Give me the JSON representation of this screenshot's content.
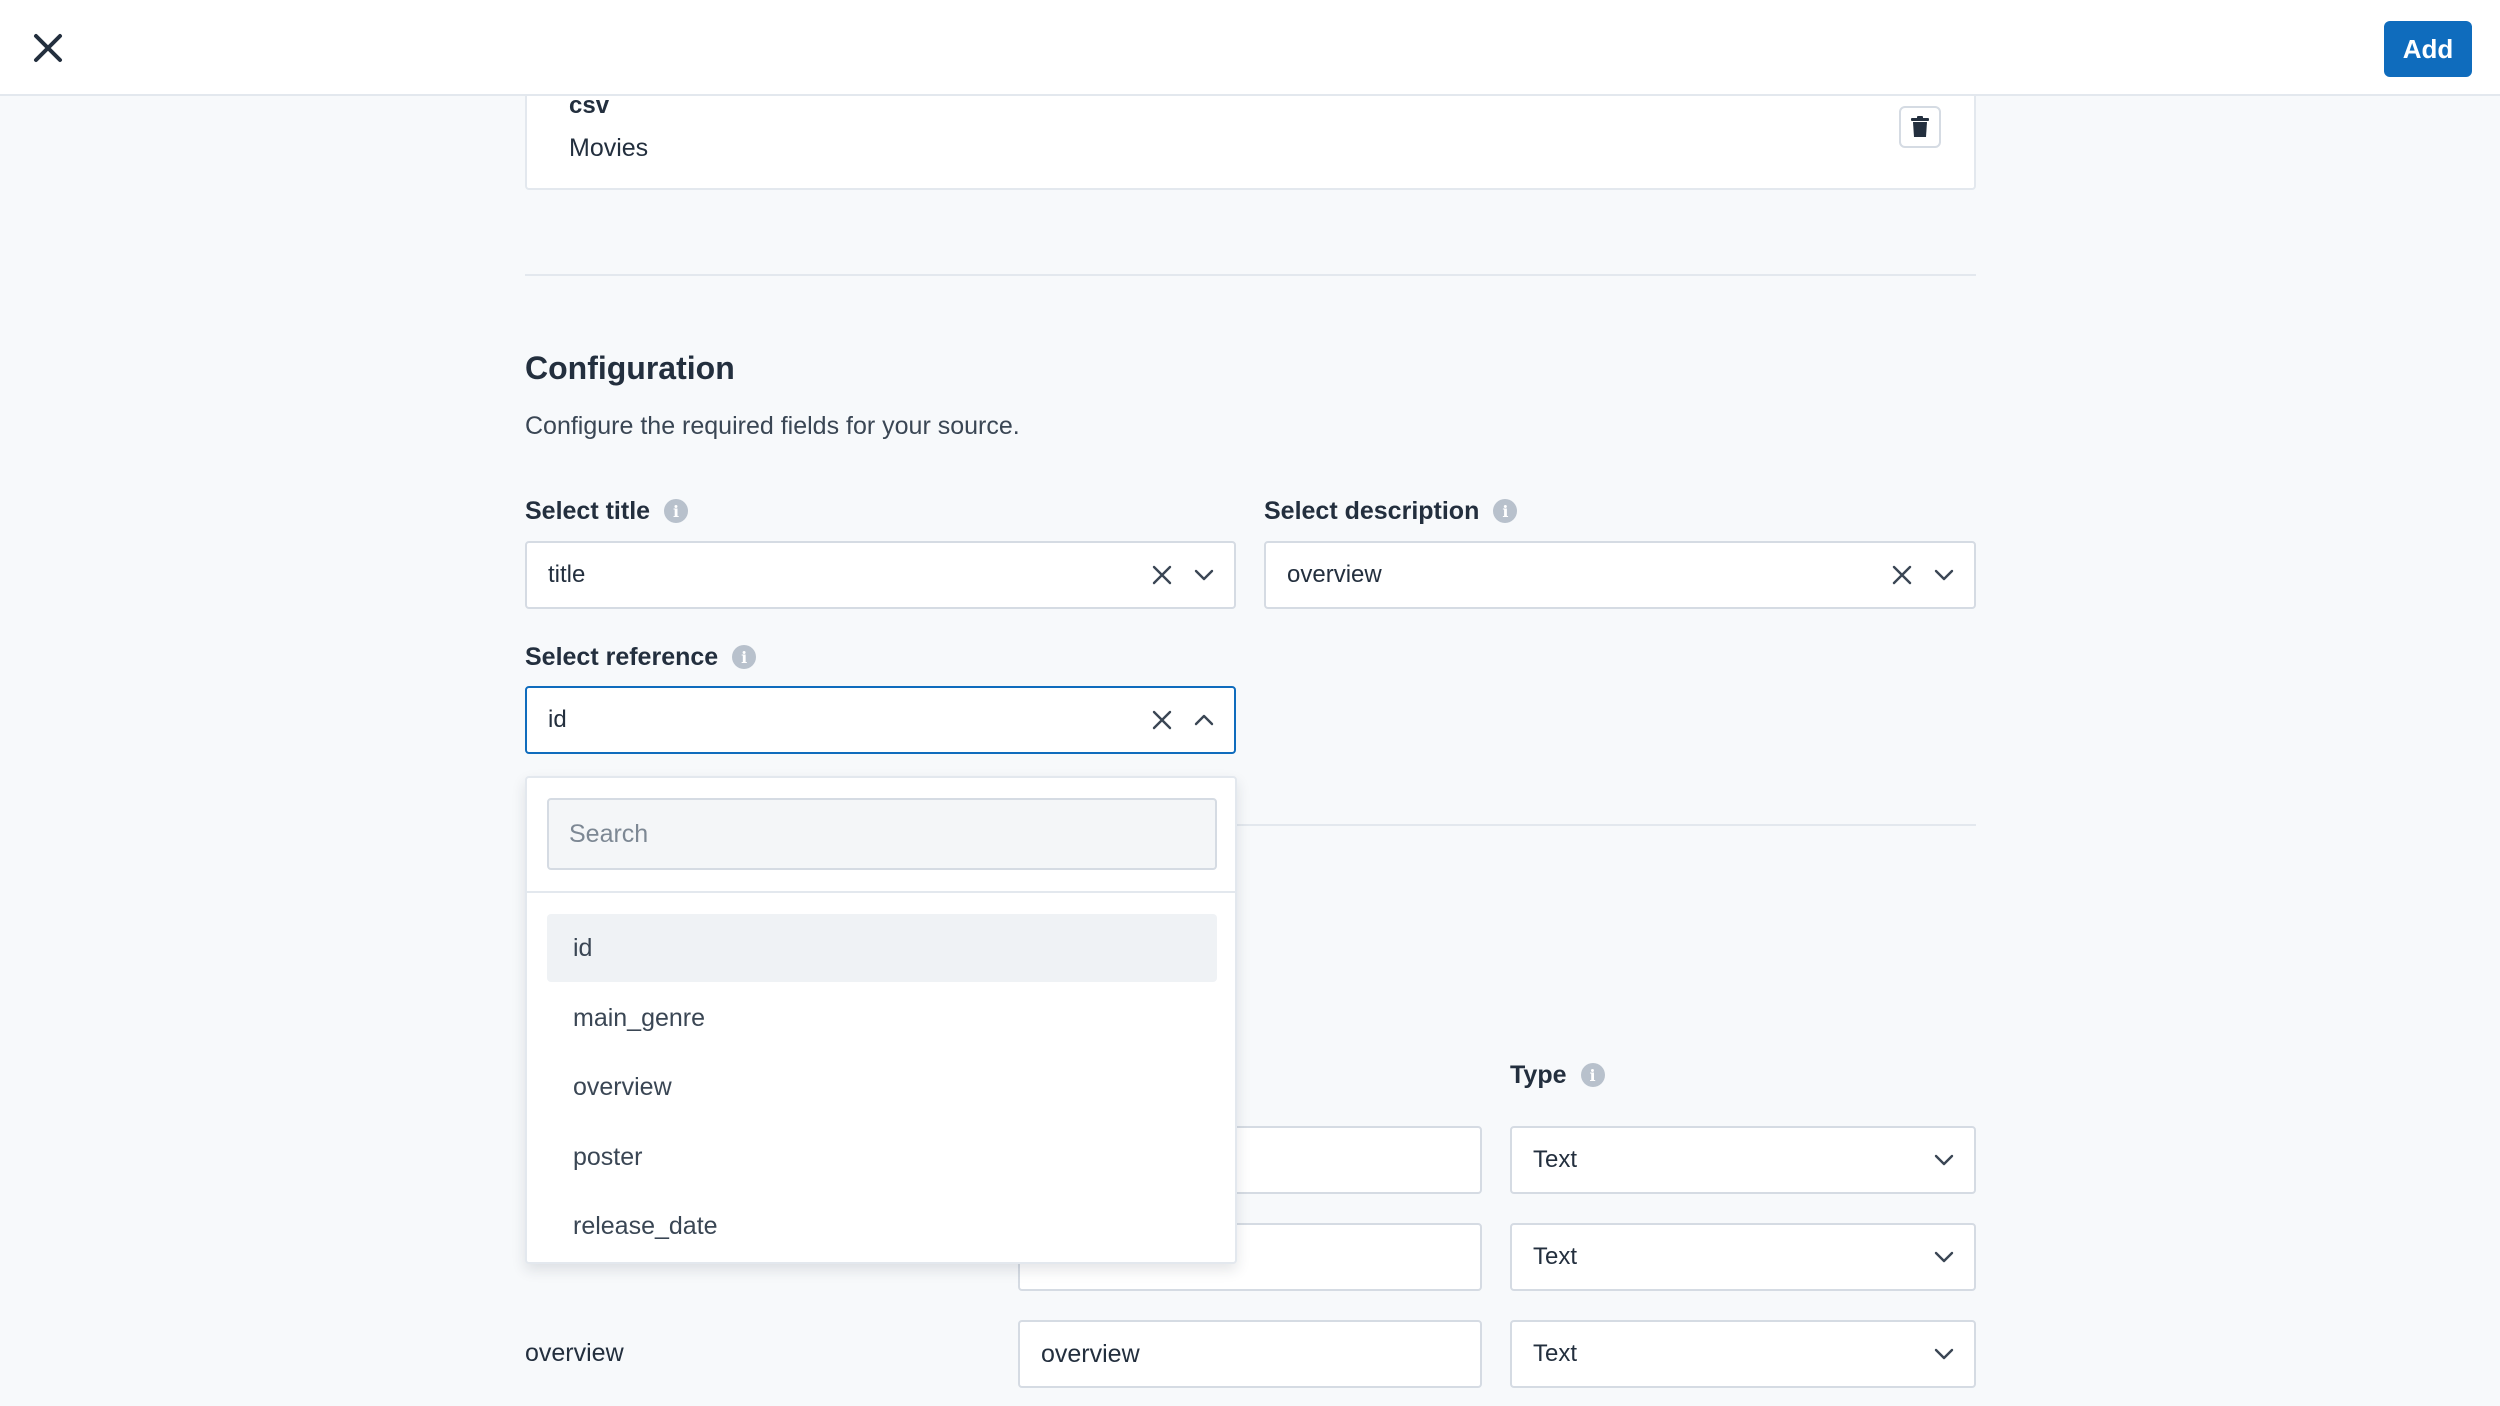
{
  "header": {
    "close_icon": "close-icon",
    "add_label": "Add",
    "accent_color": "#0f6cbd"
  },
  "source": {
    "type": "csv",
    "name": "Movies",
    "delete_icon": "trash-icon"
  },
  "configuration": {
    "title": "Configuration",
    "description": "Configure the required fields for your source.",
    "select_title": {
      "label": "Select title",
      "value": "title"
    },
    "select_description": {
      "label": "Select description",
      "value": "overview"
    },
    "select_reference": {
      "label": "Select reference",
      "value": "id"
    }
  },
  "dropdown": {
    "search_placeholder": "Search",
    "options": [
      "id",
      "main_genre",
      "overview",
      "poster",
      "release_date"
    ],
    "highlighted": "id"
  },
  "fields": {
    "type_label": "Type",
    "rows": [
      {
        "name": "",
        "value": "",
        "type": "Text"
      },
      {
        "name": "",
        "value": "",
        "type": "Text"
      },
      {
        "name": "overview",
        "value": "overview",
        "type": "Text"
      }
    ]
  }
}
